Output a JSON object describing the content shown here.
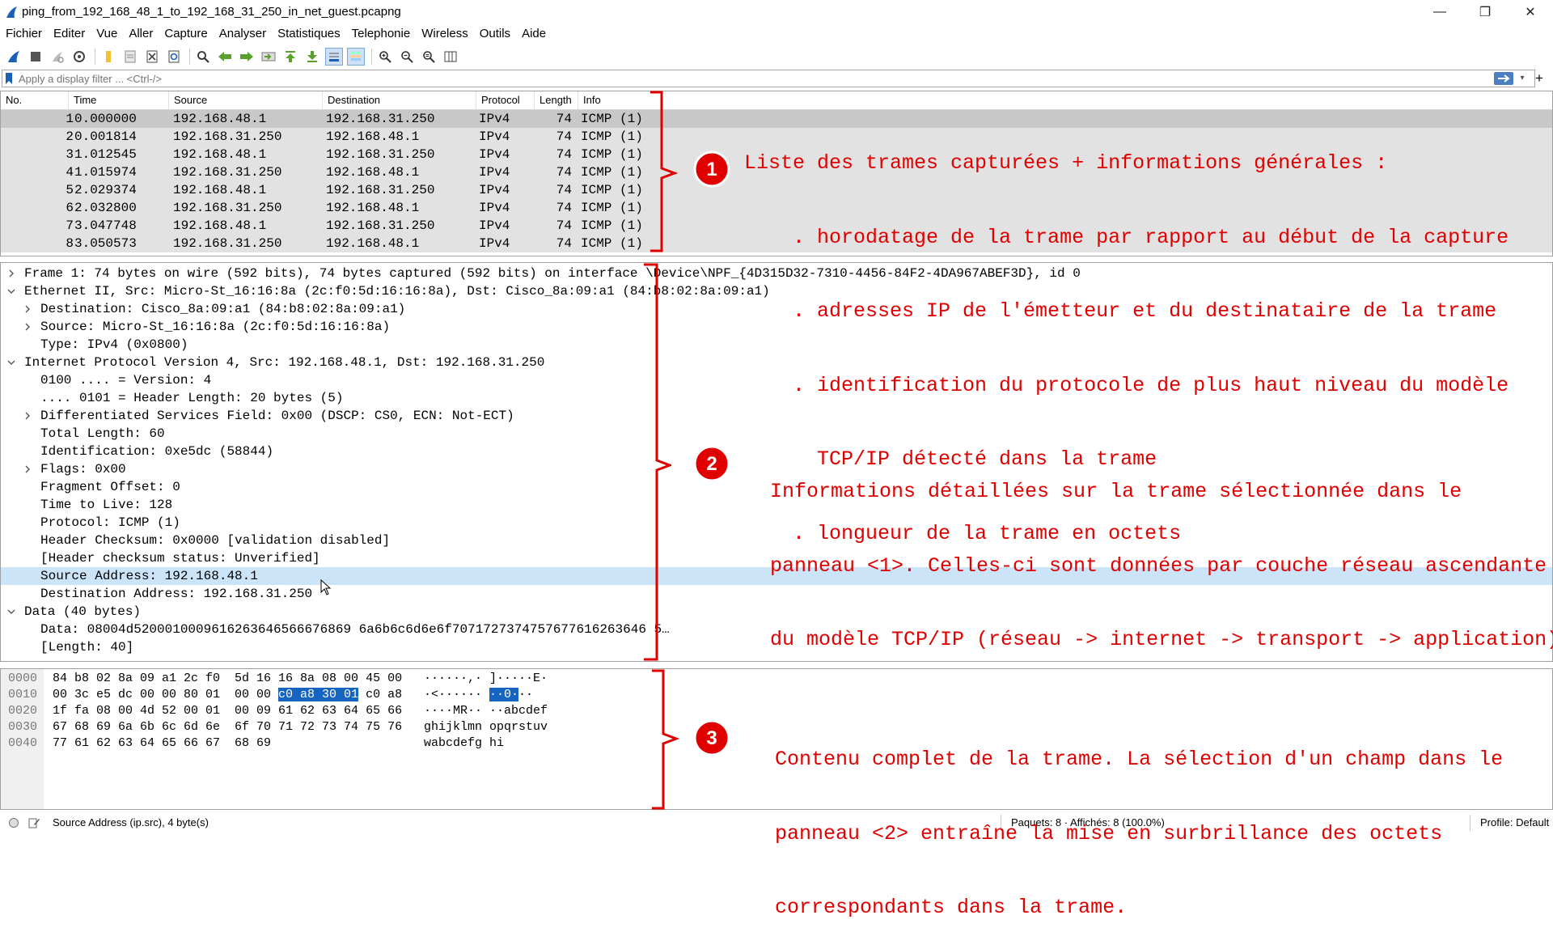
{
  "window": {
    "title": "ping_from_192_168_48_1_to_192_168_31_250_in_net_guest.pcapng",
    "minimize": "—",
    "maximize": "❐",
    "close": "✕"
  },
  "menu": [
    "Fichier",
    "Editer",
    "Vue",
    "Aller",
    "Capture",
    "Analyser",
    "Statistiques",
    "Telephonie",
    "Wireless",
    "Outils",
    "Aide"
  ],
  "toolbar_icons": [
    "shark-fin-start-icon",
    "stop-icon",
    "restart-icon",
    "capture-options-icon",
    "open-folder-icon",
    "save-file-icon",
    "close-file-icon",
    "reload-icon",
    "find-icon",
    "go-back-icon",
    "go-forward-icon",
    "go-to-packet-icon",
    "go-first-icon",
    "go-last-icon",
    "autoscroll-icon",
    "colorize-icon",
    "zoom-in-icon",
    "zoom-out-icon",
    "zoom-normal-icon",
    "resize-columns-icon"
  ],
  "filter": {
    "placeholder": "Apply a display filter ... <Ctrl-/>",
    "value": "",
    "plus": "+"
  },
  "packet_list": {
    "columns": [
      "No.",
      "Time",
      "Source",
      "Destination",
      "Protocol",
      "Length",
      "Info"
    ],
    "rows": [
      {
        "no": "1",
        "time": "0.000000",
        "src": "192.168.48.1",
        "dst": "192.168.31.250",
        "proto": "IPv4",
        "len": "74",
        "info": "ICMP (1)"
      },
      {
        "no": "2",
        "time": "0.001814",
        "src": "192.168.31.250",
        "dst": "192.168.48.1",
        "proto": "IPv4",
        "len": "74",
        "info": "ICMP (1)"
      },
      {
        "no": "3",
        "time": "1.012545",
        "src": "192.168.48.1",
        "dst": "192.168.31.250",
        "proto": "IPv4",
        "len": "74",
        "info": "ICMP (1)"
      },
      {
        "no": "4",
        "time": "1.015974",
        "src": "192.168.31.250",
        "dst": "192.168.48.1",
        "proto": "IPv4",
        "len": "74",
        "info": "ICMP (1)"
      },
      {
        "no": "5",
        "time": "2.029374",
        "src": "192.168.48.1",
        "dst": "192.168.31.250",
        "proto": "IPv4",
        "len": "74",
        "info": "ICMP (1)"
      },
      {
        "no": "6",
        "time": "2.032800",
        "src": "192.168.31.250",
        "dst": "192.168.48.1",
        "proto": "IPv4",
        "len": "74",
        "info": "ICMP (1)"
      },
      {
        "no": "7",
        "time": "3.047748",
        "src": "192.168.48.1",
        "dst": "192.168.31.250",
        "proto": "IPv4",
        "len": "74",
        "info": "ICMP (1)"
      },
      {
        "no": "8",
        "time": "3.050573",
        "src": "192.168.31.250",
        "dst": "192.168.48.1",
        "proto": "IPv4",
        "len": "74",
        "info": "ICMP (1)"
      }
    ]
  },
  "details": [
    {
      "level": 0,
      "arrow": "right",
      "text": "Frame 1: 74 bytes on wire (592 bits), 74 bytes captured (592 bits) on interface \\Device\\NPF_{4D315D32-7310-4456-84F2-4DA967ABEF3D}, id 0"
    },
    {
      "level": 0,
      "arrow": "down",
      "text": "Ethernet II, Src: Micro-St_16:16:8a (2c:f0:5d:16:16:8a), Dst: Cisco_8a:09:a1 (84:b8:02:8a:09:a1)"
    },
    {
      "level": 1,
      "arrow": "right",
      "text": "Destination: Cisco_8a:09:a1 (84:b8:02:8a:09:a1)"
    },
    {
      "level": 1,
      "arrow": "right",
      "text": "Source: Micro-St_16:16:8a (2c:f0:5d:16:16:8a)"
    },
    {
      "level": 1,
      "arrow": "none",
      "text": "Type: IPv4 (0x0800)"
    },
    {
      "level": 0,
      "arrow": "down",
      "text": "Internet Protocol Version 4, Src: 192.168.48.1, Dst: 192.168.31.250"
    },
    {
      "level": 1,
      "arrow": "none",
      "text": "0100 .... = Version: 4"
    },
    {
      "level": 1,
      "arrow": "none",
      "text": ".... 0101 = Header Length: 20 bytes (5)"
    },
    {
      "level": 1,
      "arrow": "right",
      "text": "Differentiated Services Field: 0x00 (DSCP: CS0, ECN: Not-ECT)"
    },
    {
      "level": 1,
      "arrow": "none",
      "text": "Total Length: 60"
    },
    {
      "level": 1,
      "arrow": "none",
      "text": "Identification: 0xe5dc (58844)"
    },
    {
      "level": 1,
      "arrow": "right",
      "text": "Flags: 0x00"
    },
    {
      "level": 1,
      "arrow": "none",
      "text": "Fragment Offset: 0"
    },
    {
      "level": 1,
      "arrow": "none",
      "text": "Time to Live: 128"
    },
    {
      "level": 1,
      "arrow": "none",
      "text": "Protocol: ICMP (1)"
    },
    {
      "level": 1,
      "arrow": "none",
      "text": "Header Checksum: 0x0000 [validation disabled]"
    },
    {
      "level": 1,
      "arrow": "none",
      "text": "[Header checksum status: Unverified]"
    },
    {
      "level": 1,
      "arrow": "none",
      "text": "Source Address: 192.168.48.1",
      "selected": true
    },
    {
      "level": 1,
      "arrow": "none",
      "text": "Destination Address: 192.168.31.250"
    },
    {
      "level": 0,
      "arrow": "down",
      "text": "Data (40 bytes)"
    },
    {
      "level": 1,
      "arrow": "none",
      "text": "Data: 08004d5200010009616263646566676869 6a6b6c6d6e6f7071727374757677616263646 5…"
    },
    {
      "level": 1,
      "arrow": "none",
      "text": "[Length: 40]"
    }
  ],
  "bytes": [
    {
      "off": "0000",
      "hex": "84 b8 02 8a 09 a1 2c f0  5d 16 16 8a 08 00 45 00",
      "ascii": "······,· ]·····E·"
    },
    {
      "off": "0010",
      "hex_pre": "00 3c e5 dc 00 00 80 01  00 00 ",
      "hex_sel": "c0 a8 30 01",
      "hex_post": " c0 a8",
      "ascii_pre": "·<······ ",
      "ascii_sel": "··0·",
      "ascii_post": "··"
    },
    {
      "off": "0020",
      "hex": "1f fa 08 00 4d 52 00 01  00 09 61 62 63 64 65 66",
      "ascii": "····MR·· ··abcdef"
    },
    {
      "off": "0030",
      "hex": "67 68 69 6a 6b 6c 6d 6e  6f 70 71 72 73 74 75 76",
      "ascii": "ghijklmn opqrstuv"
    },
    {
      "off": "0040",
      "hex": "77 61 62 63 64 65 66 67  68 69",
      "ascii": "wabcdefg hi"
    }
  ],
  "status": {
    "field": "Source Address (ip.src), 4 byte(s)",
    "packets": "Paquets: 8 · Affichés: 8 (100.0%)",
    "profile": "Profile: Default"
  },
  "annotations": {
    "a1": {
      "number": "1",
      "lines": [
        "Liste des trames capturées + informations générales :",
        "    . horodatage de la trame par rapport au début de la capture",
        "    . adresses IP de l'émetteur et du destinataire de la trame",
        "    . identification du protocole de plus haut niveau du modèle",
        "      TCP/IP détecté dans la trame",
        "    . longueur de la trame en octets"
      ]
    },
    "a2": {
      "number": "2",
      "lines": [
        "Informations détaillées sur la trame sélectionnée dans le",
        "panneau <1>. Celles-ci sont données par couche réseau ascendante",
        "du modèle TCP/IP (réseau -> internet -> transport -> application)."
      ]
    },
    "a3": {
      "number": "3",
      "lines": [
        "Contenu complet de la trame. La sélection d'un champ dans le",
        "panneau <2> entraîne la mise en surbrillance des octets",
        "correspondants dans la trame."
      ]
    }
  },
  "colors": {
    "annotation": "#e00000",
    "selection_blue": "#1565c0",
    "detail_highlight": "#cce4f7"
  }
}
